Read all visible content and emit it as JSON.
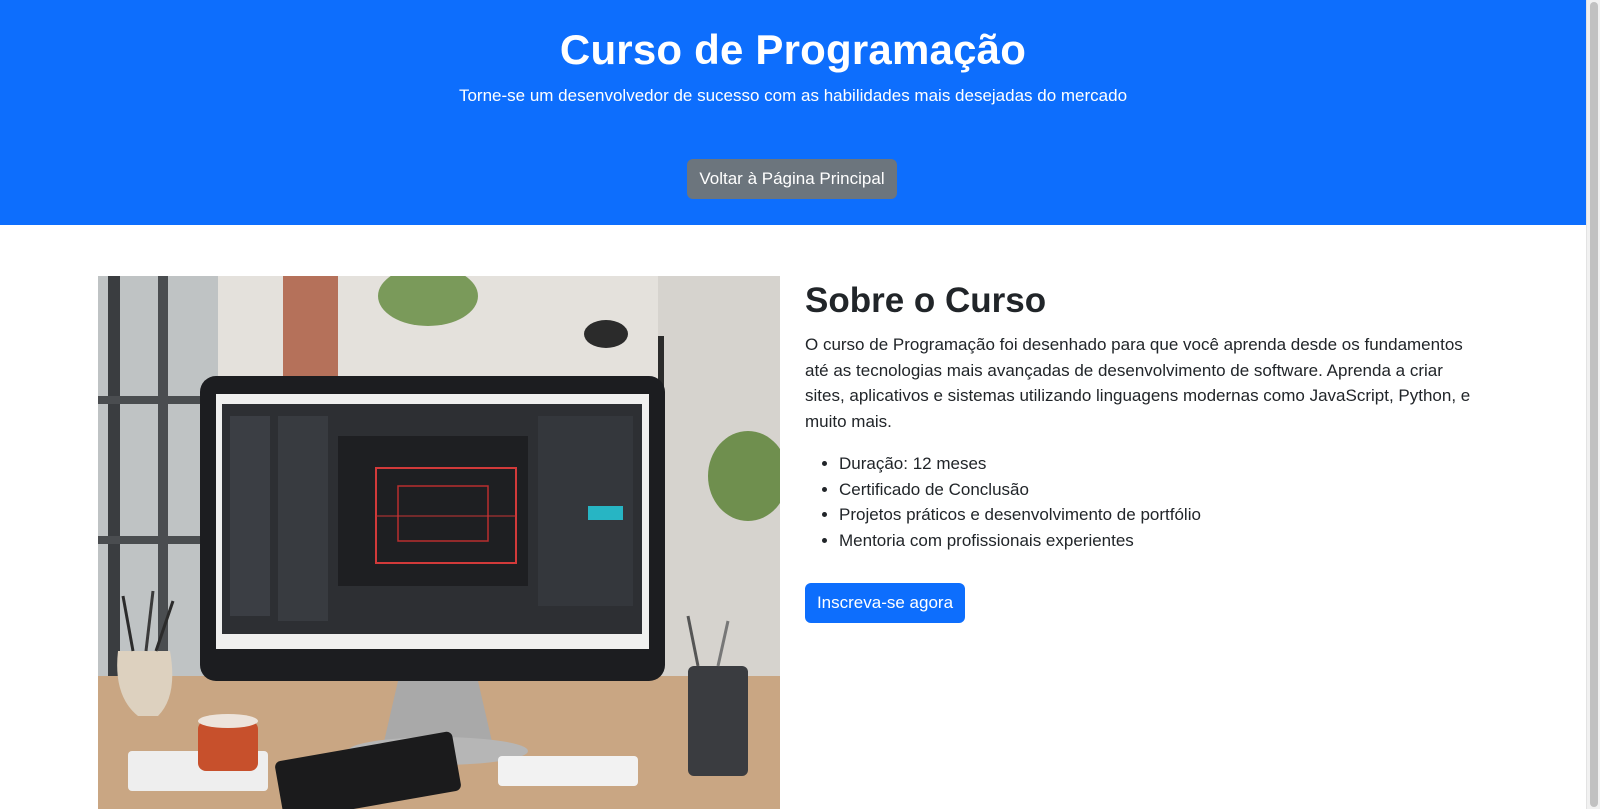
{
  "hero": {
    "title": "Curso de Programação",
    "subtitle": "Torne-se um desenvolvedor de sucesso com as habilidades mais desejadas do mercado",
    "back_button_label": "Voltar à Página Principal"
  },
  "about": {
    "heading": "Sobre o Curso",
    "description": "O curso de Programação foi desenhado para que você aprenda desde os fundamentos até as tecnologias mais avançadas de desenvolvimento de software. Aprenda a criar sites, aplicativos e sistemas utilizando linguagens modernas como JavaScript, Python, e muito mais.",
    "features": [
      "Duração: 12 meses",
      "Certificado de Conclusão",
      "Projetos práticos e desenvolvimento de portfólio",
      "Mentoria com profissionais experientes"
    ],
    "enroll_button_label": "Inscreva-se agora"
  },
  "colors": {
    "primary": "#0d6efd",
    "secondary": "#6c757d",
    "text": "#212529"
  }
}
